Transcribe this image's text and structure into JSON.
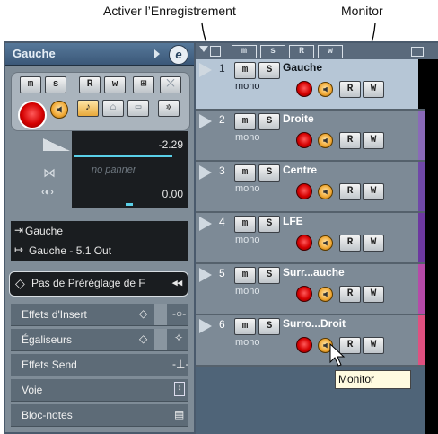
{
  "annotations": {
    "activer": "Activer l’Enregistrement",
    "monitor": "Monitor"
  },
  "inspector": {
    "title": "Gauche",
    "edit_glyph": "e",
    "buttons_row1": [
      "m",
      "s",
      "R",
      "w",
      "⊞",
      "⤫"
    ],
    "volume_value": "-2.29",
    "pan_placeholder": "no panner",
    "delay_value": "0.00",
    "input": "Gauche",
    "output": "Gauche - 5.1 Out",
    "preset": "Pas de Préréglage de F",
    "sections": [
      "Effets d'Insert",
      "Égaliseurs",
      "Effets Send",
      "Voie",
      "Bloc-notes"
    ]
  },
  "toolbar": {
    "buttons": [
      "m",
      "s",
      "R",
      "w"
    ]
  },
  "tracks": [
    {
      "num": "1",
      "name": "Gauche",
      "type": "mono",
      "color": "#000000",
      "selected": true
    },
    {
      "num": "2",
      "name": "Droite",
      "type": "mono",
      "color": "#8a6ab8",
      "selected": false
    },
    {
      "num": "3",
      "name": "Centre",
      "type": "mono",
      "color": "#7048a8",
      "selected": false
    },
    {
      "num": "4",
      "name": "LFE",
      "type": "mono",
      "color": "#6d38a0",
      "selected": false
    },
    {
      "num": "5",
      "name": "Surr...auche",
      "type": "mono",
      "color": "#b64aa8",
      "selected": false
    },
    {
      "num": "6",
      "name": "Surro...Droit",
      "type": "mono",
      "color": "#e05080",
      "selected": false
    }
  ],
  "track_buttons": {
    "m": "m",
    "s": "S",
    "r": "R",
    "w": "W"
  },
  "tooltip": "Monitor",
  "colors": {
    "record": "#d40000",
    "monitor": "#f0a630",
    "selected_track": "#b6c6d6"
  }
}
